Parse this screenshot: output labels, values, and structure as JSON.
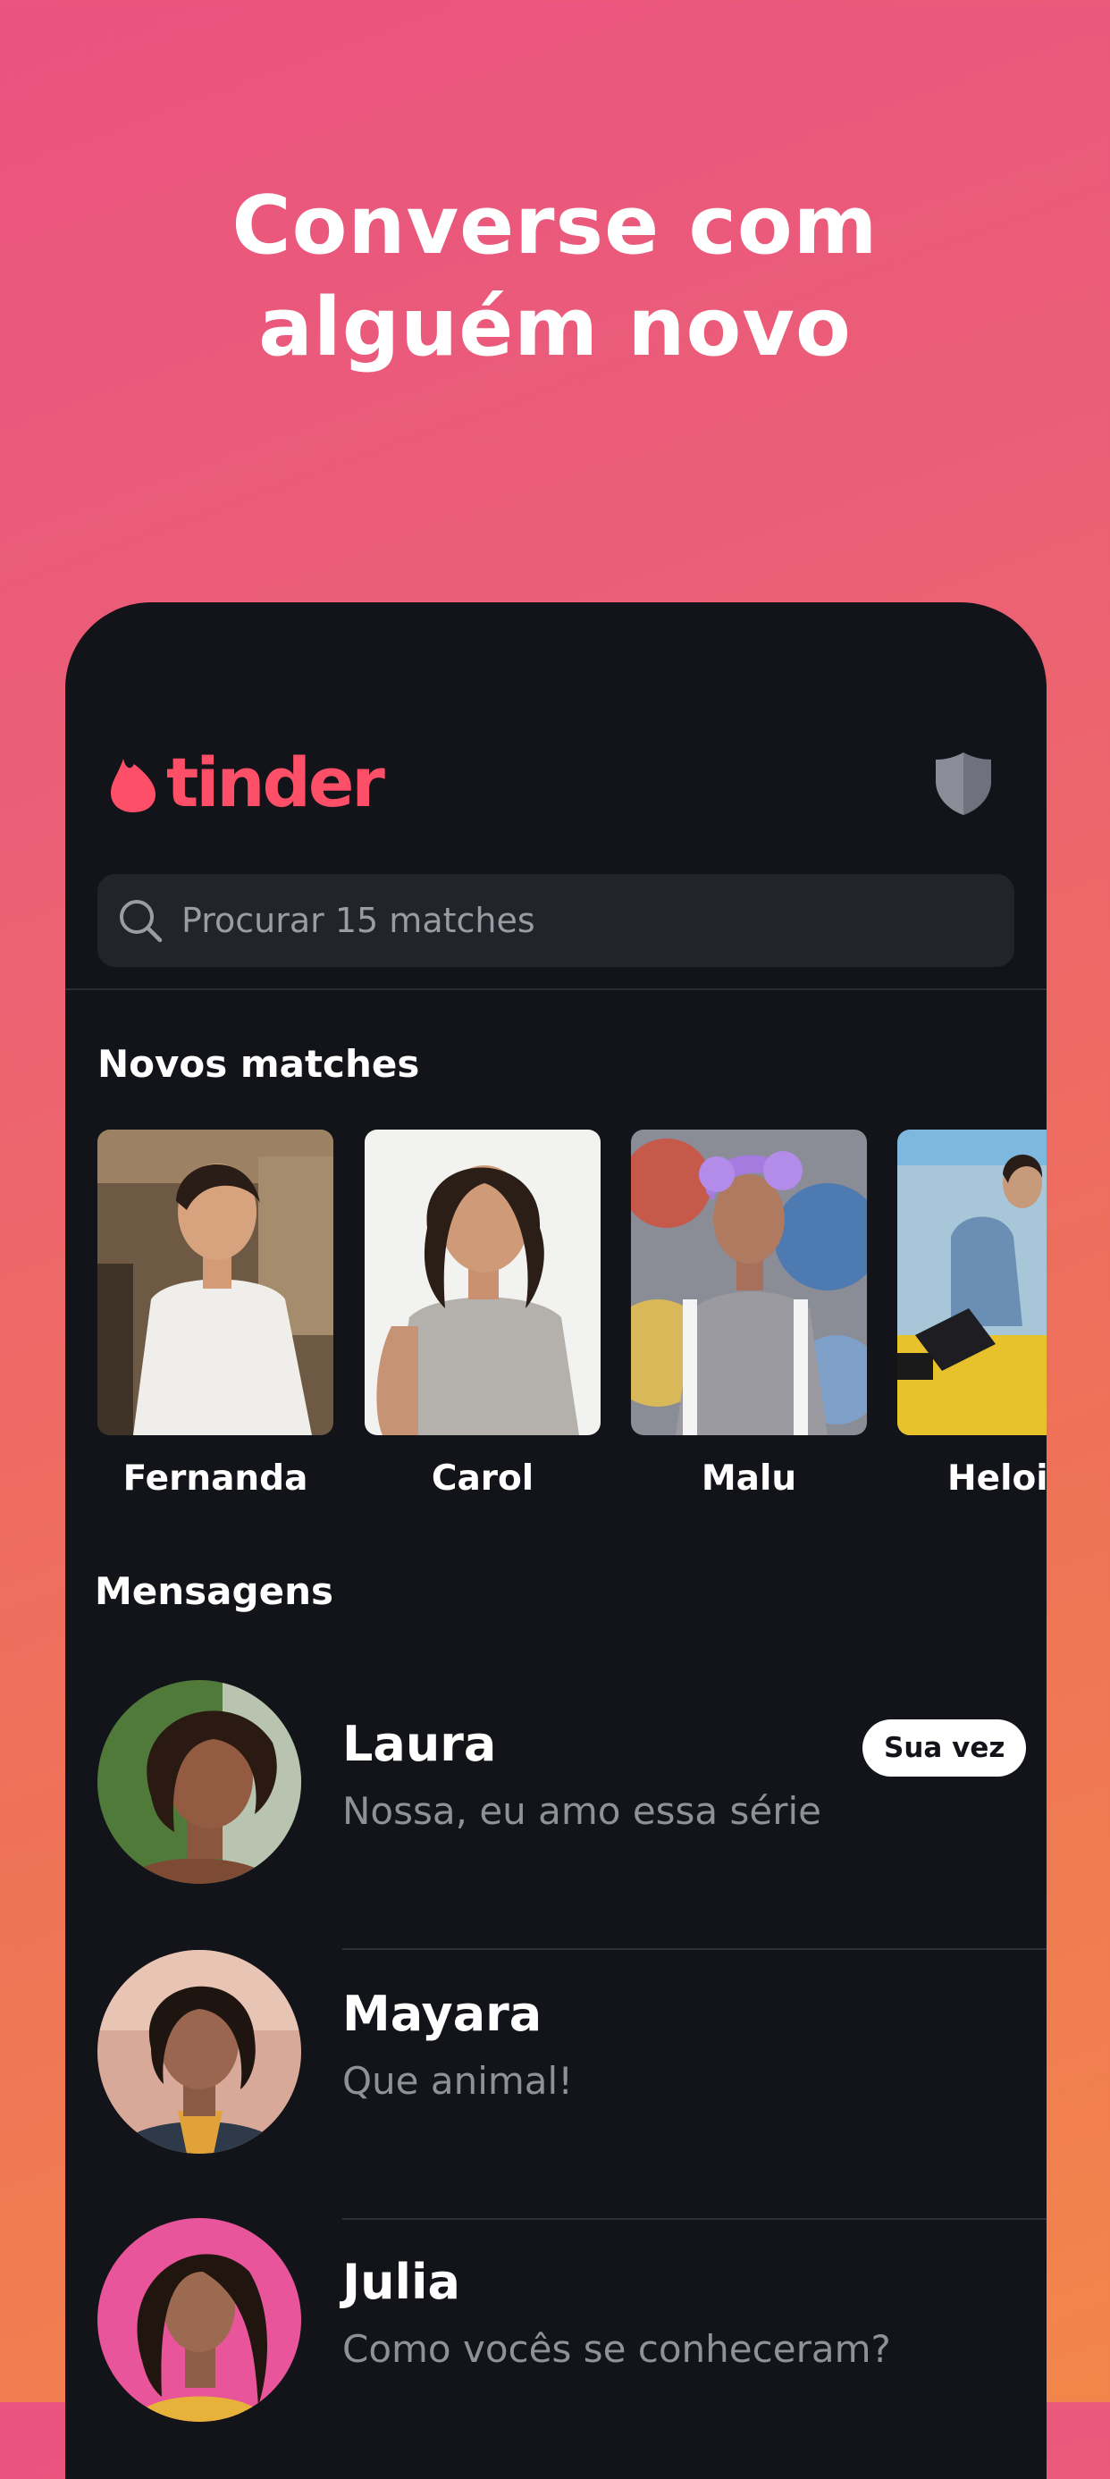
{
  "headline": {
    "line1": "Converse com",
    "line2": "alguém novo"
  },
  "app": {
    "logo_text": "tinder",
    "brand_color": "#fd5068",
    "icons": {
      "logo": "flame-icon",
      "safety": "shield-icon",
      "search": "search-icon"
    }
  },
  "search": {
    "placeholder": "Procurar 15 matches"
  },
  "new_matches": {
    "title": "Novos matches",
    "items": [
      {
        "name": "Fernanda"
      },
      {
        "name": "Carol"
      },
      {
        "name": "Malu"
      },
      {
        "name": "Heloi"
      }
    ]
  },
  "messages": {
    "title": "Mensagens",
    "items": [
      {
        "name": "Laura",
        "preview": "Nossa, eu amo essa série",
        "badge": "Sua vez"
      },
      {
        "name": "Mayara",
        "preview": "Que animal!"
      },
      {
        "name": "Julia",
        "preview": "Como vocês se conheceram?"
      }
    ]
  }
}
